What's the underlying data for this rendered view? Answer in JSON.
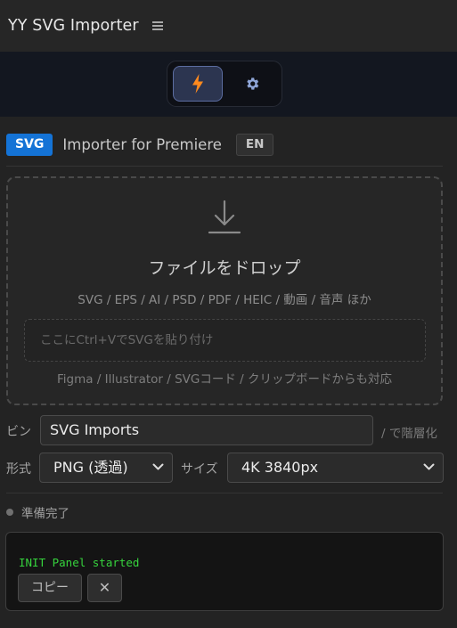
{
  "app": {
    "title": "YY SVG Importer",
    "menu_icon": "hamburger-menu-icon"
  },
  "mode_switch": {
    "active_icon": "lightning-bolt-icon",
    "settings_icon": "gear-icon",
    "active_color": "#ff8a1e",
    "settings_color": "#8fa6d8"
  },
  "header": {
    "badge": "SVG",
    "subtitle": "Importer for Premiere",
    "lang_button": "EN",
    "badge_color": "#1473d6"
  },
  "dropzone": {
    "icon": "download-arrow-icon",
    "title": "ファイルをドロップ",
    "formats": "SVG / EPS / AI / PSD / PDF / HEIC / 動画 / 音声 ほか",
    "paste_placeholder": "ここにCtrl+VでSVGを貼り付け",
    "sources": "Figma / Illustrator / SVGコード / クリップボードからも対応"
  },
  "bin": {
    "label": "ビン",
    "value": "SVG Imports",
    "hint": "/ で階層化"
  },
  "format": {
    "label": "形式",
    "selected": "PNG (透過)"
  },
  "size": {
    "label": "サイズ",
    "selected": "4K 3840px"
  },
  "status": {
    "text": "準備完了",
    "dot_color": "#707070"
  },
  "log": {
    "line": "INIT Panel started",
    "line_color": "#36d43d",
    "copy_button": "コピー",
    "clear_button": "✕"
  }
}
